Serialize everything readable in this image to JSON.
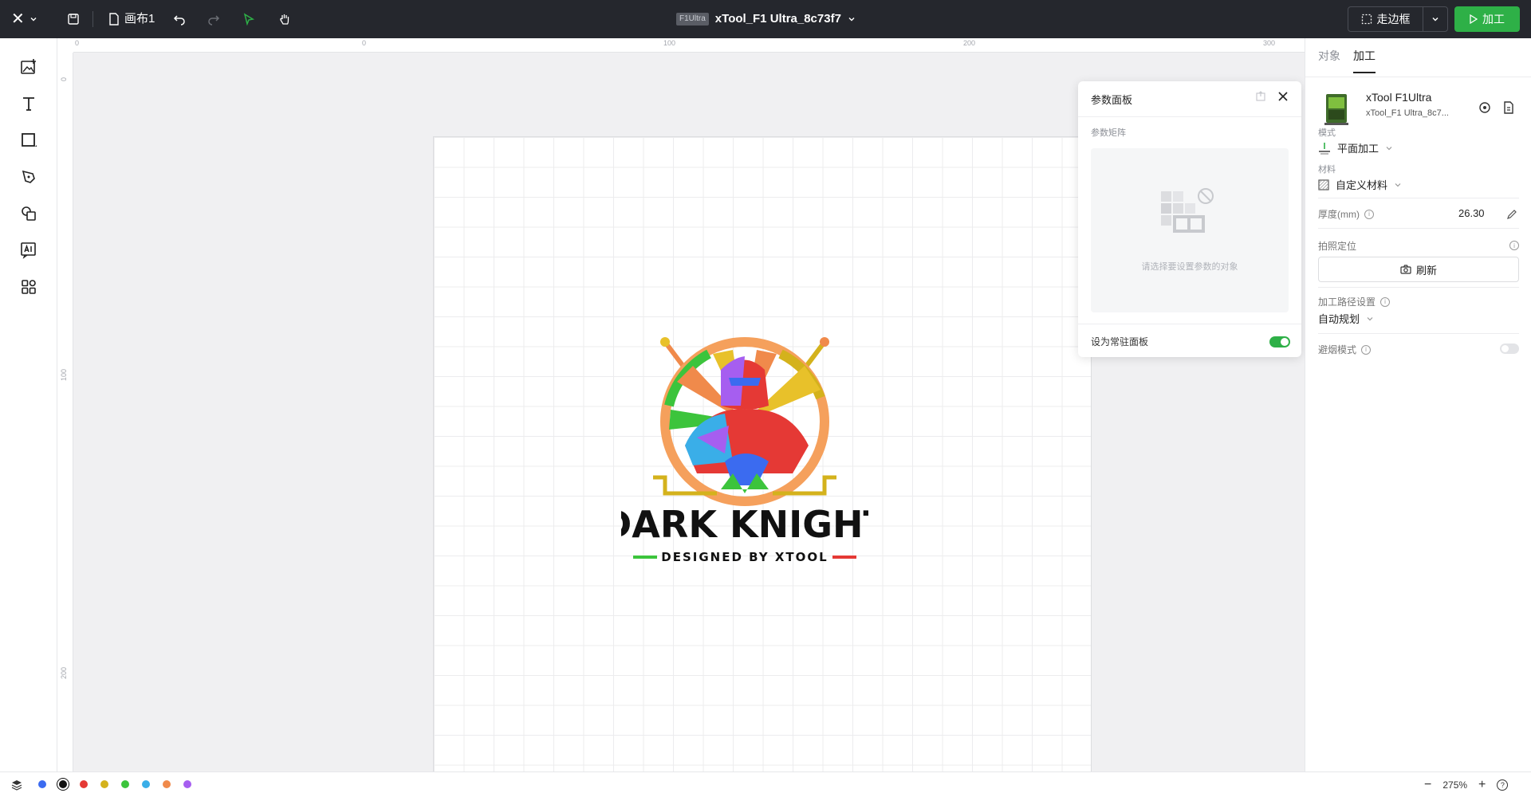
{
  "topbar": {
    "canvas_name": "画布1",
    "device_tag": "F1Ultra",
    "device_title": "xTool_F1 Ultra_8c73f7",
    "frame_button": "走边框",
    "process_button": "加工"
  },
  "rulers": {
    "h_labels": [
      "0",
      "0",
      "100",
      "200",
      "300"
    ],
    "v_labels": [
      "0",
      "100",
      "200"
    ]
  },
  "artwork": {
    "title": "DARK KNIGHT",
    "subtitle": "DESIGNED BY XTOOL"
  },
  "param_panel": {
    "title": "参数面板",
    "section": "参数矩阵",
    "empty_text": "请选择要设置参数的对象",
    "footer_label": "设为常驻面板",
    "pinned": true
  },
  "right_panel": {
    "tabs": [
      "对象",
      "加工"
    ],
    "active_tab": "加工",
    "device_name": "xTool F1Ultra",
    "device_sub": "xTool_F1 Ultra_8c7...",
    "mode_label": "模式",
    "mode_value": "平面加工",
    "material_label": "材料",
    "material_value": "自定义材料",
    "thickness_label": "厚度(mm)",
    "thickness_value": "26.30",
    "camera_label": "拍照定位",
    "refresh_button": "刷新",
    "path_label": "加工路径设置",
    "path_value": "自动规划",
    "smoke_label": "避烟模式",
    "smoke_enabled": false
  },
  "bottombar": {
    "swatch_colors": [
      "#3b6bf0",
      "#111111",
      "#e53935",
      "#d4b21c",
      "#3cc43c",
      "#3aaee8",
      "#f08a4b",
      "#a65ef0"
    ],
    "zoom": "275%"
  },
  "colors": {
    "accent": "#2eb047",
    "topbar_bg": "#25272d"
  }
}
